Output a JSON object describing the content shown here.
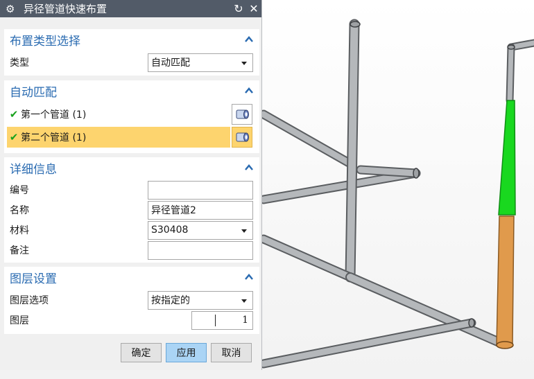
{
  "dialog": {
    "title": "异径管道快速布置",
    "icons": {
      "settings": "gear-icon",
      "reset": "refresh-icon",
      "close": "close-icon"
    }
  },
  "sections": {
    "layout_type": {
      "title": "布置类型选择",
      "type_label": "类型",
      "type_value": "自动匹配"
    },
    "auto_match": {
      "title": "自动匹配",
      "first_pipe": "第一个管道 (1)",
      "second_pipe": "第二个管道 (1)"
    },
    "details": {
      "title": "详细信息",
      "number_label": "编号",
      "number_value": "",
      "name_label": "名称",
      "name_value": "异径管道2",
      "material_label": "材料",
      "material_value": "S30408",
      "note_label": "备注",
      "note_value": ""
    },
    "layer": {
      "title": "图层设置",
      "option_label": "图层选项",
      "option_value": "按指定的",
      "layer_label": "图层",
      "layer_value": "1"
    }
  },
  "buttons": {
    "ok": "确定",
    "apply": "应用",
    "cancel": "取消"
  },
  "colors": {
    "title_bar": "#525b68",
    "section_title": "#2a6bb1",
    "selected_row": "#fdd46e",
    "apply_button": "#aad4f5",
    "check": "#18a11d",
    "pipe_green": "#19d81f",
    "pipe_orange": "#e09a4c",
    "pipe_gray": "#b0b3b6"
  }
}
